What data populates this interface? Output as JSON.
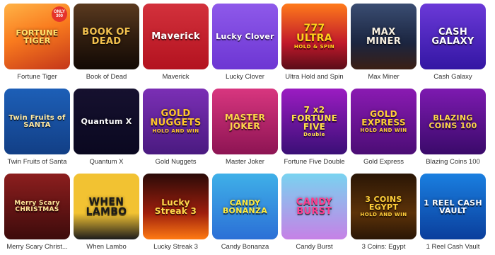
{
  "games": [
    {
      "title": "Fortune Tiger",
      "logo": "FORTUNE TIGER",
      "sub": "",
      "badge": "ONLY 300",
      "bg": "linear-gradient(160deg,#ffb347 0%,#f97b1e 45%,#c4361a 100%)",
      "fg": "#ffe36e",
      "size": 11
    },
    {
      "title": "Book of Dead",
      "logo": "BOOK OF DEAD",
      "sub": "",
      "badge": "",
      "bg": "linear-gradient(180deg,#5a3a1f 0%,#2e1c0e 55%,#120904 100%)",
      "fg": "#f2c14e",
      "size": 13
    },
    {
      "title": "Maverick",
      "logo": "Maverick",
      "sub": "",
      "badge": "",
      "bg": "linear-gradient(180deg,#d3313c 0%,#b3121f 100%)",
      "fg": "#ffffff",
      "size": 13
    },
    {
      "title": "Lucky Clover",
      "logo": "Lucky Clover",
      "sub": "",
      "badge": "",
      "bg": "linear-gradient(180deg,#8e59ea 0%,#6d36d3 100%)",
      "fg": "#ffffff",
      "size": 11
    },
    {
      "title": "Ultra Hold and Spin",
      "logo": "777 ULTRA",
      "sub": "HOLD & SPIN",
      "badge": "",
      "bg": "linear-gradient(180deg,#ff7a1a 0%,#c0192b 60%,#5a0c18 100%)",
      "fg": "#ffd21a",
      "size": 14
    },
    {
      "title": "Max Miner",
      "logo": "MAX MINER",
      "sub": "",
      "badge": "",
      "bg": "linear-gradient(180deg,#3a4d72 0%,#1b2540 60%,#3b1f14 100%)",
      "fg": "#f8f0e0",
      "size": 13
    },
    {
      "title": "Cash Galaxy",
      "logo": "CASH GALAXY",
      "sub": "",
      "badge": "",
      "bg": "linear-gradient(180deg,#6b39d8 0%,#3316a3 100%)",
      "fg": "#ffffff",
      "size": 13
    },
    {
      "title": "Twin Fruits of Santa",
      "logo": "Twin Fruits of SANTA",
      "sub": "",
      "badge": "",
      "bg": "linear-gradient(180deg,#1d5fb7 0%,#123f86 100%)",
      "fg": "#ffe9a0",
      "size": 10
    },
    {
      "title": "Quantum X",
      "logo": "Quantum X",
      "sub": "",
      "badge": "",
      "bg": "linear-gradient(180deg,#16112f 0%,#0a0820 100%)",
      "fg": "#ffffff",
      "size": 11
    },
    {
      "title": "Gold Nuggets",
      "logo": "GOLD NUGGETS",
      "sub": "HOLD AND WIN",
      "badge": "",
      "bg": "linear-gradient(180deg,#7b2fb5 0%,#4a1a80 100%)",
      "fg": "#ffc72a",
      "size": 13
    },
    {
      "title": "Master Joker",
      "logo": "MASTER JOKER",
      "sub": "",
      "badge": "",
      "bg": "linear-gradient(180deg,#d8367f 0%,#8d1453 100%)",
      "fg": "#ffd54a",
      "size": 12
    },
    {
      "title": "Fortune Five Double",
      "logo": "7 x2 FORTUNE FIVE",
      "sub": "Double",
      "badge": "",
      "bg": "linear-gradient(180deg,#9b1cc2 0%,#3a0f76 100%)",
      "fg": "#ffe14a",
      "size": 12
    },
    {
      "title": "Gold Express",
      "logo": "GOLD EXPRESS",
      "sub": "HOLD AND WIN",
      "badge": "",
      "bg": "linear-gradient(180deg,#8a1ab2 0%,#4b0d75 100%)",
      "fg": "#ffcf36",
      "size": 12
    },
    {
      "title": "Blazing Coins 100",
      "logo": "BLAZING COINS 100",
      "sub": "",
      "badge": "",
      "bg": "linear-gradient(180deg,#7d1ab0 0%,#3a0a6a 100%)",
      "fg": "#ffd84a",
      "size": 11
    },
    {
      "title": "Merry Scary Christ...",
      "logo": "Merry Scary CHRISTMAS",
      "sub": "",
      "badge": "",
      "bg": "linear-gradient(180deg,#8c1e1e 0%,#3d0b0b 100%)",
      "fg": "#ffe79a",
      "size": 9
    },
    {
      "title": "When Lambo",
      "logo": "WHEN LAMBO",
      "sub": "",
      "badge": "",
      "bg": "linear-gradient(180deg,#f2c232 0%,#f2c232 60%,#1c1c1c 100%)",
      "fg": "#1a1a1a",
      "size": 14
    },
    {
      "title": "Lucky Streak 3",
      "logo": "Lucky Streak 3",
      "sub": "",
      "badge": "",
      "bg": "linear-gradient(180deg,#2a0a08 0%,#9e1f0d 60%,#ff7a12 100%)",
      "fg": "#ffd84a",
      "size": 12
    },
    {
      "title": "Candy Bonanza",
      "logo": "CANDY BONANZA",
      "sub": "",
      "badge": "",
      "bg": "linear-gradient(180deg,#3fb0e8 0%,#2b6fd6 100%)",
      "fg": "#ffea3b",
      "size": 11
    },
    {
      "title": "Candy Burst",
      "logo": "CANDY BURST",
      "sub": "",
      "badge": "",
      "bg": "linear-gradient(180deg,#79d3f0 0%,#c681e6 100%)",
      "fg": "#ff3d8e",
      "size": 13
    },
    {
      "title": "3 Coins: Egypt",
      "logo": "3 COINS EGYPT",
      "sub": "HOLD AND WIN",
      "badge": "",
      "bg": "linear-gradient(180deg,#2a1606 0%,#5c3208 60%,#2a1606 100%)",
      "fg": "#ffcf3a",
      "size": 11
    },
    {
      "title": "1 Reel Cash Vault",
      "logo": "1 REEL CASH VAULT",
      "sub": "",
      "badge": "",
      "bg": "linear-gradient(180deg,#1a7fe0 0%,#0a3e9c 100%)",
      "fg": "#ffffff",
      "size": 11
    }
  ]
}
